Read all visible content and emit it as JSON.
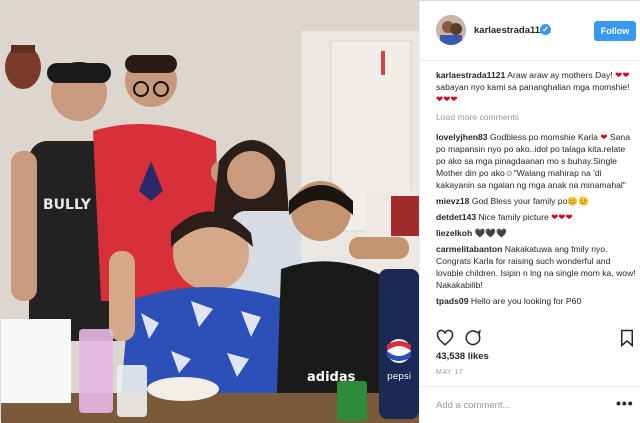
{
  "post": {
    "username": "karlaestrada1121",
    "follow_label": "Follow",
    "caption_user": "karlaestrada1121",
    "caption_text": "Araw araw ay mothers Day!",
    "caption_hearts": "❤❤",
    "caption_text2": "sabayan nyo kami sa pananghalian mga momshie!",
    "caption_hearts2": "❤❤❤",
    "load_more": "Load more comments",
    "likes": "43,538 likes",
    "date": "MAY 17",
    "add_comment_placeholder": "Add a comment...",
    "more_icon": "•••"
  },
  "comments": [
    {
      "user": "lovelyjhen83",
      "text": "Godbless po momshie Karla",
      "tail": "Sana po mapansin nyo po ako..idol po talaga kita.relate po ako sa mga pinagdaanan mo s buhay.Single Mother din po ako☺\"Walang mahirap na 'di kakayanin sa ngalan ng mga anak na minamahal\""
    },
    {
      "user": "mievz18",
      "text": "God Bless your family po😊😊"
    },
    {
      "user": "detdet143",
      "text": "Nice family picture",
      "hearts": "❤❤❤"
    },
    {
      "user": "liezelkoh",
      "text": "",
      "hearts": "🖤🖤🖤"
    },
    {
      "user": "carmelitabanton",
      "text": "Nakakatuwa ang fmily nyo. Congrats Karla for raising such wonderful and lovable children. Isipin n lng na single mom ka, wow! Nakakabilib!"
    },
    {
      "user": "tpads09",
      "text": "Hello are you looking for P60"
    }
  ],
  "colors": {
    "accent": "#3897f0",
    "heart": "#d0021b",
    "muted": "#999999"
  },
  "icons": [
    "verified-icon",
    "heart-icon",
    "comment-icon",
    "bookmark-icon",
    "more-options-icon"
  ],
  "photo_text": {
    "tank_print": "BULLY PROOF",
    "bottle_brand": "pepsi",
    "shirt_brand": "adidas"
  }
}
